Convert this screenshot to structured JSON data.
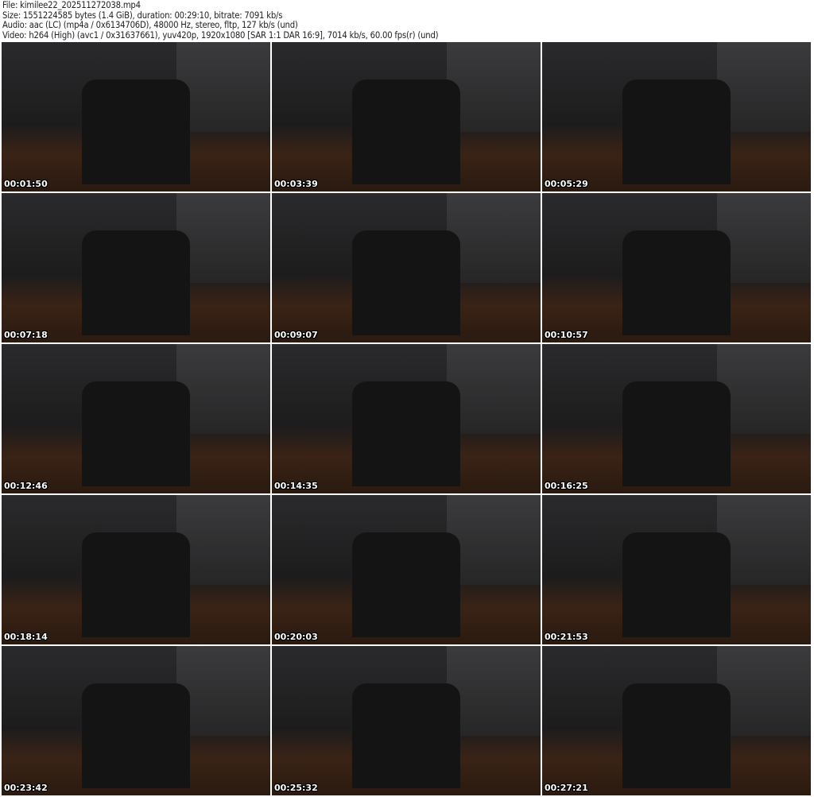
{
  "header": {
    "file": "File: kimilee22_202511272038.mp4",
    "size": "Size: 1551224585 bytes (1.4 GiB), duration: 00:29:10, bitrate: 7091 kb/s",
    "audio": "Audio: aac (LC) (mp4a / 0x6134706D), 48000 Hz, stereo, fltp, 127 kb/s (und)",
    "video": "Video: h264 (High) (avc1 / 0x31637661), yuv420p, 1920x1080 [SAR 1:1 DAR 16:9], 7014 kb/s, 60.00 fps(r) (und)"
  },
  "thumbnails": [
    {
      "timestamp": "00:01:50"
    },
    {
      "timestamp": "00:03:39"
    },
    {
      "timestamp": "00:05:29"
    },
    {
      "timestamp": "00:07:18"
    },
    {
      "timestamp": "00:09:07"
    },
    {
      "timestamp": "00:10:57"
    },
    {
      "timestamp": "00:12:46"
    },
    {
      "timestamp": "00:14:35"
    },
    {
      "timestamp": "00:16:25"
    },
    {
      "timestamp": "00:18:14"
    },
    {
      "timestamp": "00:20:03"
    },
    {
      "timestamp": "00:21:53"
    },
    {
      "timestamp": "00:23:42"
    },
    {
      "timestamp": "00:25:32"
    },
    {
      "timestamp": "00:27:21"
    }
  ]
}
